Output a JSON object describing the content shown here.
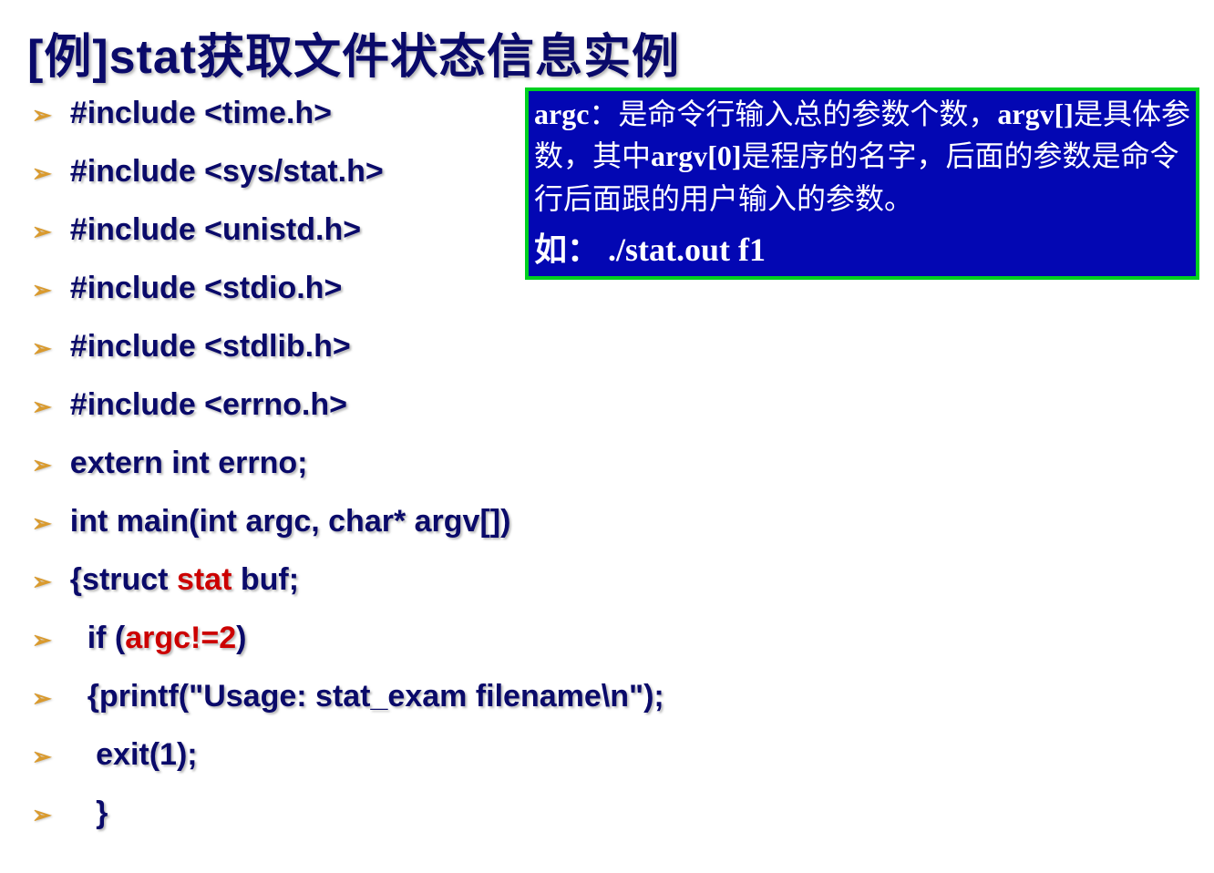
{
  "title": "[例]stat获取文件状态信息实例",
  "code_lines": [
    {
      "segments": [
        {
          "text": "#include <time.h>"
        }
      ]
    },
    {
      "segments": [
        {
          "text": "#include <sys/stat.h>"
        }
      ]
    },
    {
      "segments": [
        {
          "text": "#include <unistd.h>"
        }
      ]
    },
    {
      "segments": [
        {
          "text": "#include <stdio.h>"
        }
      ]
    },
    {
      "segments": [
        {
          "text": "#include <stdlib.h>"
        }
      ]
    },
    {
      "segments": [
        {
          "text": "#include <errno.h>"
        }
      ]
    },
    {
      "segments": [
        {
          "text": "extern int errno;"
        }
      ]
    },
    {
      "segments": [
        {
          "text": "int main(int argc, char* argv[])"
        }
      ]
    },
    {
      "segments": [
        {
          "text": "{struct "
        },
        {
          "text": "stat",
          "red": true
        },
        {
          "text": " buf;"
        }
      ]
    },
    {
      "segments": [
        {
          "text": "  if (",
          "pre": true
        },
        {
          "text": "argc!=2",
          "red": true
        },
        {
          "text": ")"
        }
      ]
    },
    {
      "segments": [
        {
          "text": "  {printf(\"Usage: stat_exam filename\\n\");",
          "pre": true
        }
      ]
    },
    {
      "segments": [
        {
          "text": "   exit(1);",
          "pre": true
        }
      ]
    },
    {
      "segments": [
        {
          "text": "   }",
          "pre": true
        }
      ]
    }
  ],
  "info_box": {
    "line1_argc": "argc",
    "line1_after": "：是命令行输入总的参数个数，",
    "line2_argv": "argv[]",
    "line2_mid": "是具体参数，其中",
    "line2_argv0": "argv[0]",
    "line2_after": "是程序的名字，后面的参数是命令行后面跟的用户输入的参数。",
    "example_label": "如：",
    "example_cmd": " ./stat.out   f1"
  }
}
